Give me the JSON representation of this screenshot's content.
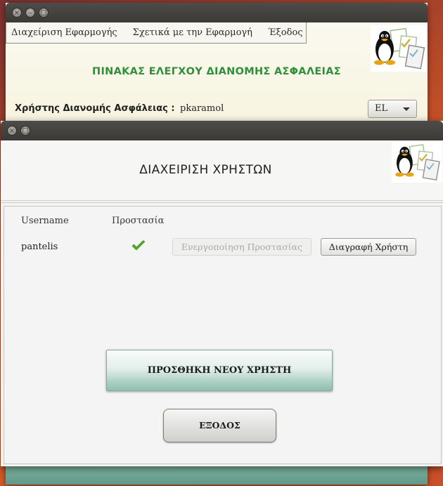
{
  "back_window": {
    "menu": [
      "Διαχείριση Εφαρμογής",
      "Σχετικά με την Εφαρμογή",
      "Έξοδος"
    ],
    "main_title": "ΠΙΝΑΚΑΣ ΕΛΕΓΧΟΥ ΔΙΑΝΟΜΗΣ ΑΣΦΑΛΕΙΑΣ",
    "user_label": "Χρήστης Διανομής Ασφάλειας :",
    "user_value": "pkaramol",
    "language": "EL"
  },
  "front_window": {
    "page_title": "ΔΙΑΧΕΙΡΙΣΗ ΧΡΗΣΤΩΝ",
    "columns": [
      "Username",
      "Προστασία"
    ],
    "users": [
      {
        "username": "pantelis",
        "protected": true,
        "enable_protection_label": "Ενεργοποίηση Προστασίας",
        "delete_label": "Διαγραφή Χρήστη"
      }
    ],
    "add_user_label": "ΠΡΟΣΘΗΚΗ ΝΕΟΥ ΧΡΗΣΤΗ",
    "exit_label": "ΕΞΟΔΟΣ"
  },
  "colors": {
    "title_green": "#2f8f3a",
    "check_green": "#4caf2a",
    "desktop_orange": "#c8502a"
  },
  "icons": [
    "close-icon",
    "minimize-icon",
    "maximize-icon",
    "tux-logo-icon",
    "checkmark-icon",
    "dropdown-caret-icon"
  ]
}
